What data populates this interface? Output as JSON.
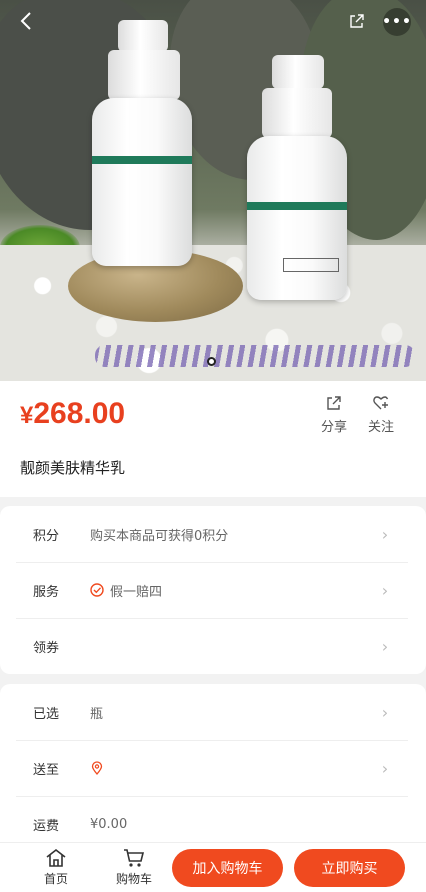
{
  "header": {
    "back_icon": "chevron-left-icon",
    "share_icon": "share-icon",
    "more_label": "•••"
  },
  "product": {
    "currency": "¥",
    "price": "268.00",
    "name": "靓颜美肤精华乳"
  },
  "actions": {
    "share_label": "分享",
    "follow_label": "关注"
  },
  "info_card": {
    "rows": [
      {
        "label": "积分",
        "value": "购买本商品可获得0积分"
      },
      {
        "label": "服务",
        "value": "假一赔四"
      },
      {
        "label": "领券",
        "value": ""
      }
    ]
  },
  "spec_card": {
    "rows": [
      {
        "label": "已选",
        "value": "瓶"
      },
      {
        "label": "送至",
        "value": ""
      },
      {
        "label": "运费",
        "value": "¥0.00"
      }
    ]
  },
  "bottom_nav": {
    "home_label": "首页",
    "cart_label": "购物车",
    "add_cart_label": "加入购物车",
    "buy_now_label": "立即购买"
  },
  "colors": {
    "accent": "#f04a1f",
    "price": "#e8401f"
  }
}
